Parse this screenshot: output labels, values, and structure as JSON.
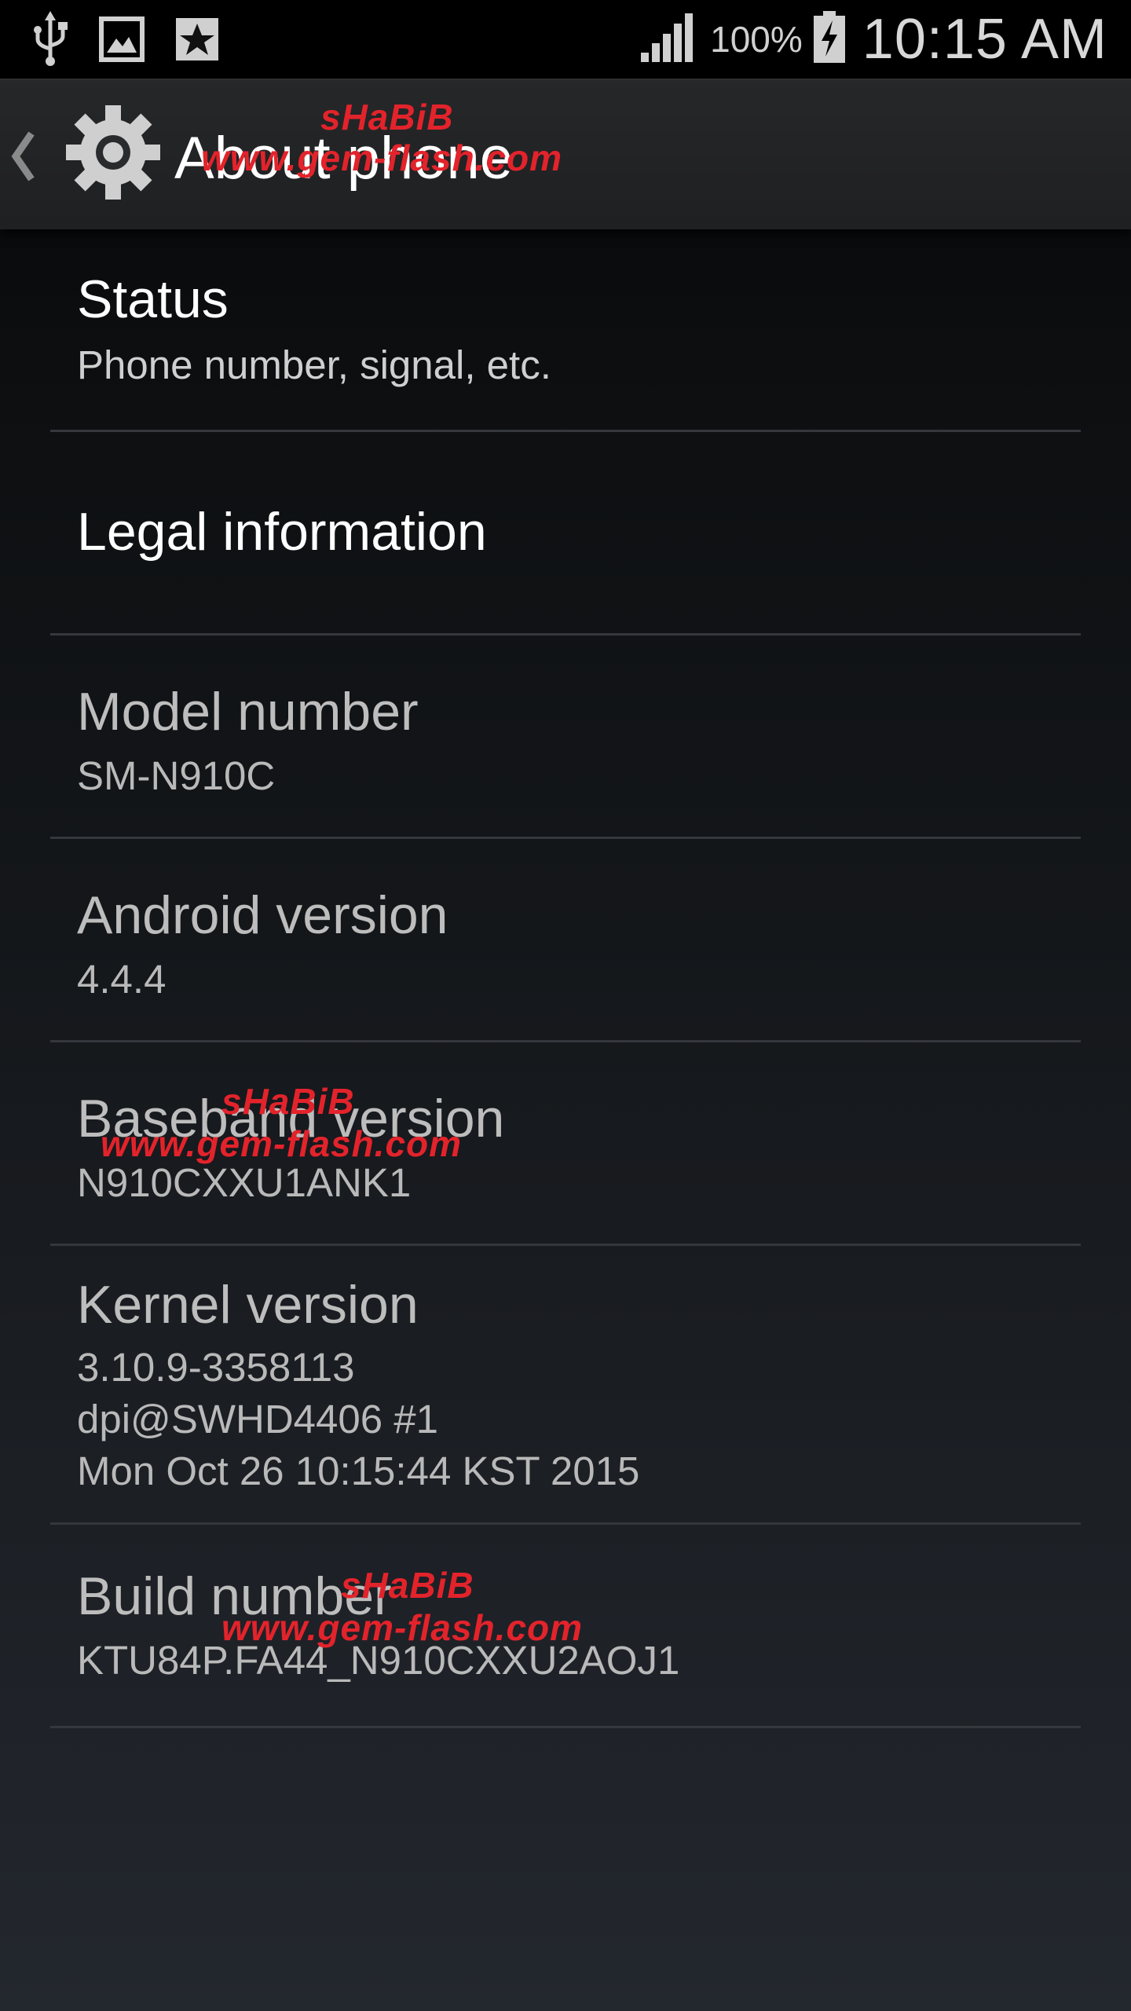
{
  "status_bar": {
    "icons_left": [
      "usb-icon",
      "picture-icon",
      "star-badge-icon"
    ],
    "icons_right": [
      "signal-icon",
      "battery-charging-icon"
    ],
    "battery_percent": "100%",
    "time": "10:15 AM"
  },
  "action_bar": {
    "up_icon": "chevron-left-icon",
    "app_icon": "gear-icon",
    "title": "About phone"
  },
  "items": [
    {
      "id": "status",
      "title": "Status",
      "summary": "Phone number, signal, etc.",
      "clickable": true
    },
    {
      "id": "legal",
      "title": "Legal information",
      "summary": "",
      "clickable": true
    },
    {
      "id": "model",
      "title": "Model number",
      "summary": "SM-N910C",
      "clickable": false
    },
    {
      "id": "android",
      "title": "Android version",
      "summary": "4.4.4",
      "clickable": false
    },
    {
      "id": "baseband",
      "title": "Baseband version",
      "summary": "N910CXXU1ANK1",
      "clickable": false
    },
    {
      "id": "kernel",
      "title": "Kernel version",
      "summary": "3.10.9-3358113\ndpi@SWHD4406 #1\nMon Oct 26 10:15:44 KST 2015",
      "clickable": false
    },
    {
      "id": "build",
      "title": "Build number",
      "summary": "KTU84P.FA44_N910CXXU2AOJ1",
      "clickable": false
    }
  ],
  "watermarks": [
    {
      "name": "sHaBiB",
      "site": "www.gem-flash.com"
    },
    {
      "name": "sHaBiB",
      "site": "www.gem-flash.com"
    },
    {
      "name": "sHaBiB",
      "site": "www.gem-flash.com"
    }
  ],
  "colors": {
    "watermark": "#e3232b",
    "divider": "#34373c",
    "title_text": "#ffffff"
  }
}
